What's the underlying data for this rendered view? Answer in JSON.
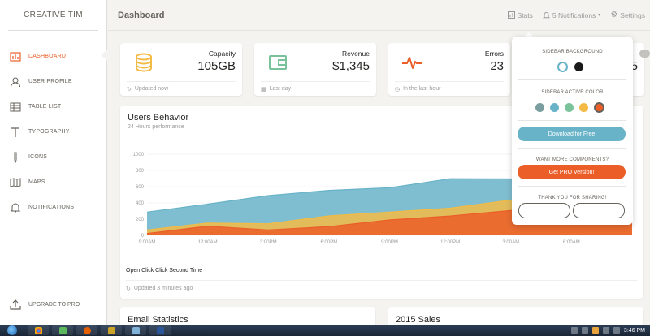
{
  "brand": "CREATIVE TIM",
  "sidebar": {
    "items": [
      {
        "label": "DASHBOARD",
        "icon": "bar-chart-icon",
        "active": true
      },
      {
        "label": "USER PROFILE",
        "icon": "user-icon"
      },
      {
        "label": "TABLE LIST",
        "icon": "table-icon"
      },
      {
        "label": "TYPOGRAPHY",
        "icon": "typography-icon"
      },
      {
        "label": "ICONS",
        "icon": "pencil-icon"
      },
      {
        "label": "MAPS",
        "icon": "map-icon"
      },
      {
        "label": "NOTIFICATIONS",
        "icon": "bell-icon"
      }
    ],
    "upgrade": "UPGRADE TO PRO"
  },
  "topbar": {
    "title": "Dashboard",
    "stats": "Stats",
    "notifications": "5 Notifications",
    "settings": "Settings"
  },
  "stats": [
    {
      "label": "Capacity",
      "value": "105GB",
      "footer": "Updated now",
      "icon": "database-icon",
      "color": "#f3bb45"
    },
    {
      "label": "Revenue",
      "value": "$1,345",
      "footer": "Last day",
      "icon": "wallet-icon",
      "color": "#7ac29a"
    },
    {
      "label": "Errors",
      "value": "23",
      "footer": "In the last hour",
      "icon": "pulse-icon",
      "color": "#eb5e28"
    },
    {
      "label": "",
      "value": "5",
      "footer": "",
      "icon": "",
      "color": "#68b3c8"
    }
  ],
  "chart": {
    "title": "Users Behavior",
    "subtitle": "24 Hours performance",
    "legend": "Open Click Click Second Time",
    "footer": "Updated 3 minutes ago"
  },
  "chart_data": {
    "type": "area",
    "categories": [
      "9:00AM",
      "12:00AM",
      "3:00PM",
      "6:00PM",
      "9:00PM",
      "12:00PM",
      "3:00AM",
      "6:00AM"
    ],
    "ylim": [
      0,
      1000
    ],
    "yticks": [
      0,
      200,
      400,
      600,
      800,
      1000
    ],
    "series": [
      {
        "color": "#68b3c8",
        "values": [
          287,
          385,
          490,
          554,
          586,
          698,
          695,
          752,
          788
        ]
      },
      {
        "color": "#f3bb45",
        "values": [
          67,
          152,
          143,
          240,
          287,
          335,
          435,
          437,
          539
        ]
      },
      {
        "color": "#eb5e28",
        "values": [
          23,
          113,
          67,
          108,
          190,
          239,
          307,
          308,
          439
        ]
      }
    ]
  },
  "settings_panel": {
    "bg_heading": "SIDEBAR BACKGROUND",
    "bg_colors": [
      "#ffffff",
      "#1a1a1a"
    ],
    "active_heading": "SIDEBAR ACTIVE COLOR",
    "active_colors": [
      "#7a9e9f",
      "#68b3c8",
      "#7ac29a",
      "#f3bb45",
      "#eb5e28"
    ],
    "download": "Download for Free",
    "more_heading": "WANT MORE COMPONENTS?",
    "pro": "Get PRO Version!",
    "thanks": "THANK YOU FOR SHARING!"
  },
  "lower": {
    "email": "Email Statistics",
    "sales": "2015 Sales"
  },
  "taskbar": {
    "time": "3:46 PM"
  }
}
